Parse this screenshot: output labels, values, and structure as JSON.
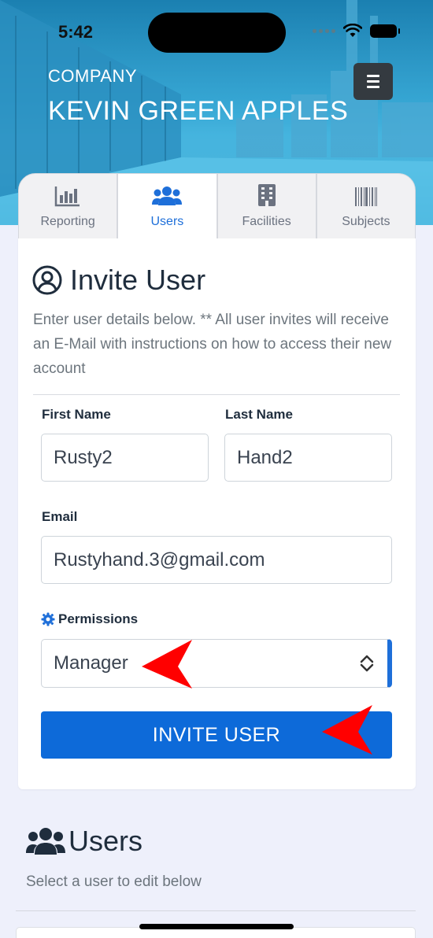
{
  "status_bar": {
    "time": "5:42"
  },
  "header": {
    "company_label": "COMPANY",
    "company_name": "KEVIN GREEN APPLES"
  },
  "tabs": [
    {
      "label": "Reporting",
      "icon": "bar-chart-icon",
      "active": false
    },
    {
      "label": "Users",
      "icon": "users-icon",
      "active": true
    },
    {
      "label": "Facilities",
      "icon": "building-icon",
      "active": false
    },
    {
      "label": "Subjects",
      "icon": "barcode-icon",
      "active": false
    }
  ],
  "invite": {
    "title": "Invite User",
    "description": "Enter user details below. ** All user invites will receive an E-Mail with instructions on how to access their new account",
    "first_name_label": "First Name",
    "first_name_value": "Rusty2",
    "last_name_label": "Last Name",
    "last_name_value": "Hand2",
    "email_label": "Email",
    "email_value": "Rustyhand.3@gmail.com",
    "permissions_label": "Permissions",
    "permissions_value": "Manager",
    "submit_label": "INVITE USER"
  },
  "users": {
    "title": "Users",
    "subtitle": "Select a user to edit below"
  },
  "colors": {
    "accent": "#0d6ad9",
    "annotation_arrow": "#ff0000",
    "menu_button": "#343a40"
  }
}
